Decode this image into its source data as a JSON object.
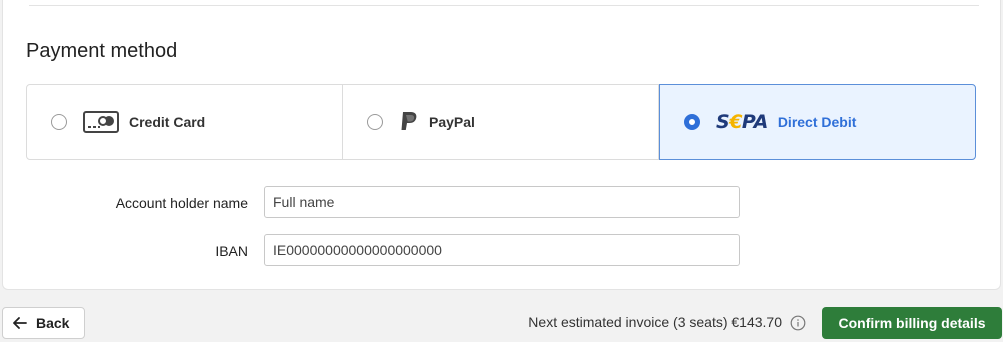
{
  "payment": {
    "title": "Payment method",
    "options": [
      {
        "label": "Credit Card",
        "icon": "credit-card-icon",
        "selected": false
      },
      {
        "label": "PayPal",
        "icon": "paypal-icon",
        "selected": false
      },
      {
        "label": "Direct Debit",
        "icon": "sepa-logo",
        "logo_text_1": "S",
        "logo_text_2": "€",
        "logo_text_3": "PA",
        "selected": true
      }
    ]
  },
  "form": {
    "account_holder": {
      "label": "Account holder name",
      "placeholder": "Full name",
      "value": ""
    },
    "iban": {
      "label": "IBAN",
      "placeholder": "IE00000000000000000000",
      "value": ""
    }
  },
  "footer": {
    "back_label": "Back",
    "invoice_text": "Next estimated invoice (3 seats) €143.70",
    "confirm_label": "Confirm billing details"
  },
  "colors": {
    "accent": "#2f6fd8",
    "confirm": "#2e7d3a",
    "selected_bg": "#eaf3ff"
  }
}
